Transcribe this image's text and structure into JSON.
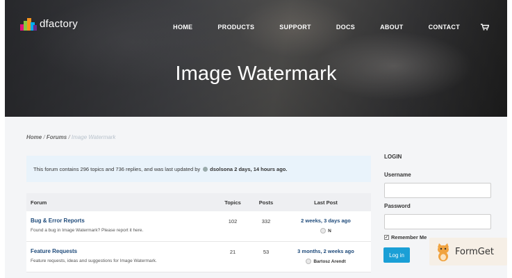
{
  "brand": {
    "name": "dfactory"
  },
  "nav": {
    "items": [
      "HOME",
      "PRODUCTS",
      "SUPPORT",
      "DOCS",
      "ABOUT",
      "CONTACT"
    ],
    "cart_icon": "cart-icon"
  },
  "hero": {
    "title": "Image Watermark"
  },
  "breadcrumb": {
    "home": "Home",
    "sep1": " / ",
    "forums": "Forums",
    "sep2": " / ",
    "current": "Image Watermark"
  },
  "notice": {
    "text": "This forum contains 296 topics and 736 replies, and was last updated by",
    "user": "dsolsona",
    "when": "2 days, 14 hours ago."
  },
  "table": {
    "headers": {
      "forum": "Forum",
      "topics": "Topics",
      "posts": "Posts",
      "last": "Last Post"
    },
    "rows": [
      {
        "name": "Bug & Error Reports",
        "desc": "Found a bug in Image Watermark? Please report it here.",
        "topics": "102",
        "posts": "332",
        "last": "2 weeks, 3 days ago",
        "user": "N"
      },
      {
        "name": "Feature Requests",
        "desc": "Feature requests, ideas and suggestions for Image Watermark.",
        "topics": "21",
        "posts": "53",
        "last": "3 months, 2 weeks ago",
        "user": "Bartosz Arendt"
      }
    ]
  },
  "login": {
    "title": "LOGIN",
    "username_label": "Username",
    "password_label": "Password",
    "remember": "Remember Me",
    "button": "Log in",
    "remember_checked": true
  },
  "badge": {
    "text": "FormGet"
  },
  "colors": {
    "accent": "#1a9fd6",
    "link": "#1e4a7a"
  }
}
